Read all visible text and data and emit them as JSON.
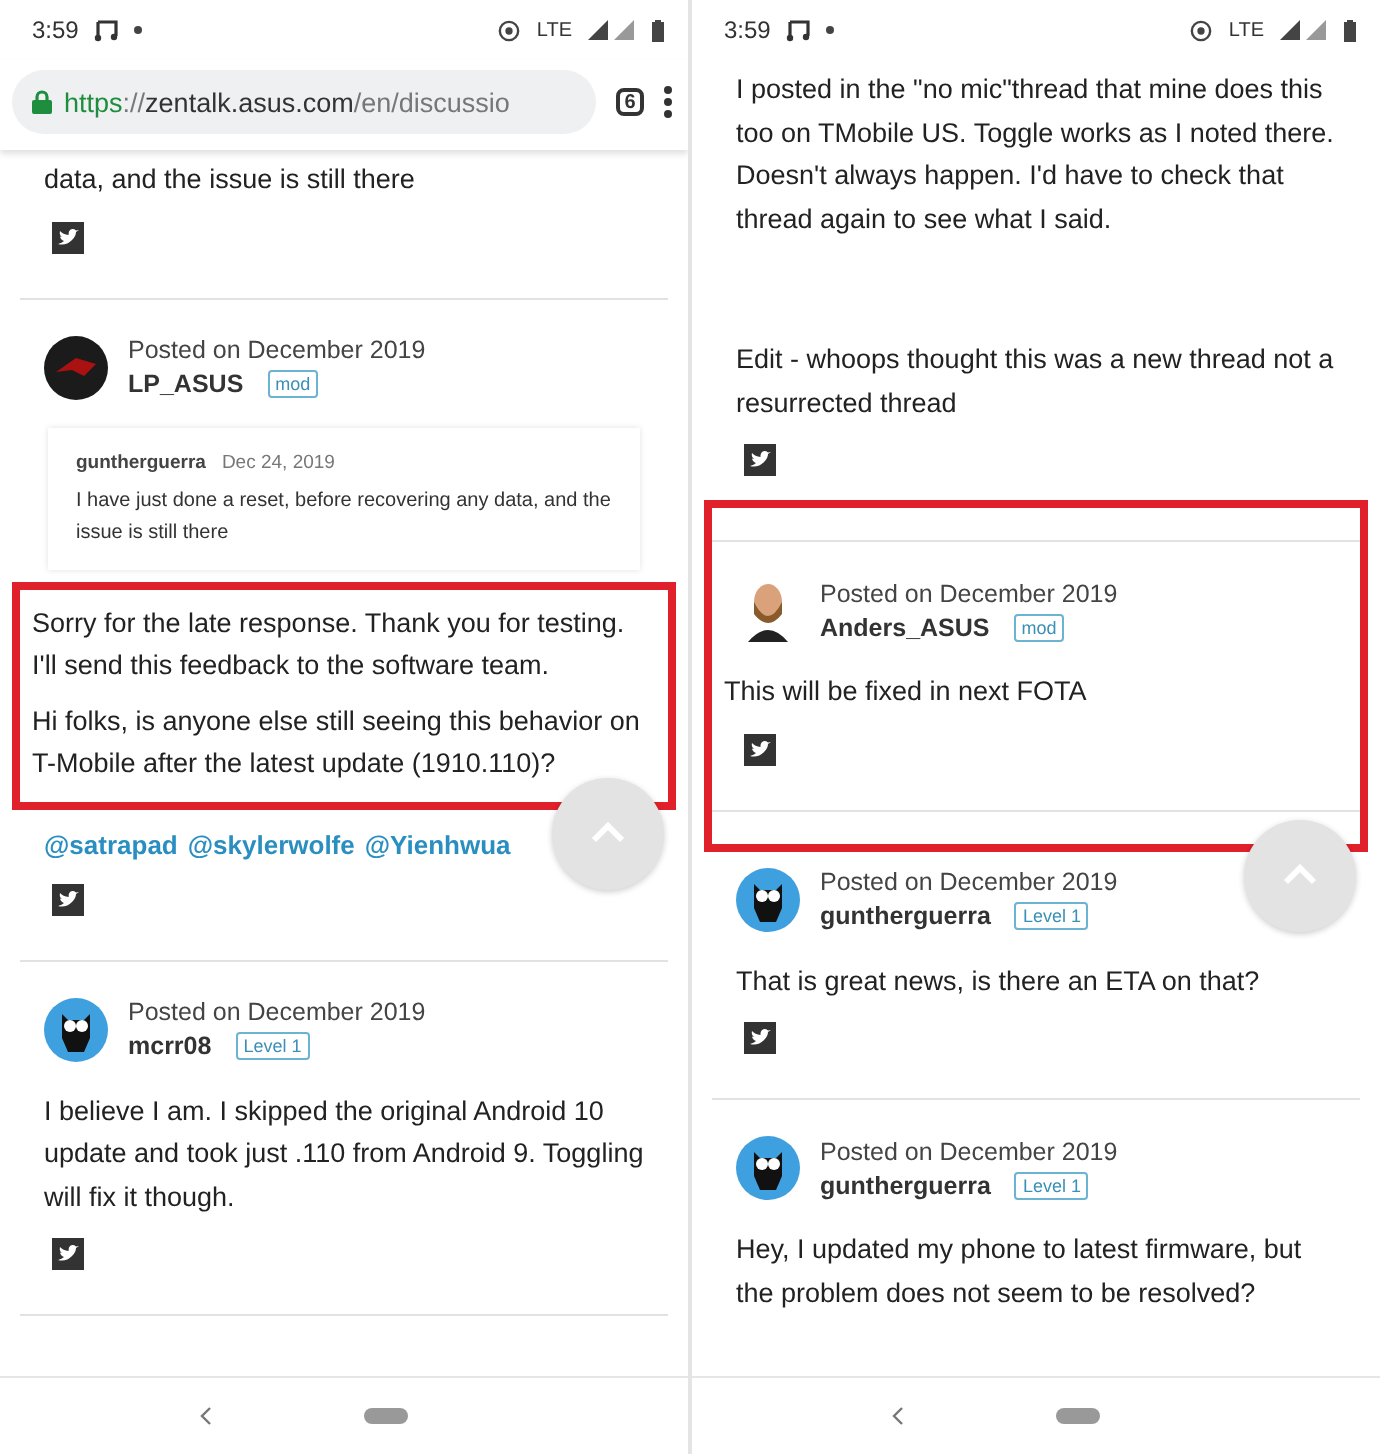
{
  "panels": [
    {
      "status_bar": {
        "time": "3:59",
        "network": "LTE"
      },
      "url_bar": {
        "url": [
          {
            "kind": "secure",
            "text": "https"
          },
          {
            "kind": "dim",
            "text": "://"
          },
          {
            "kind": "host",
            "text": "zentalk.asus.com"
          },
          {
            "kind": "dim",
            "text": "/en/discussio"
          }
        ],
        "tab_count": "6"
      },
      "blocks": [
        {
          "kind": "text",
          "text": "data, and the issue is still there"
        },
        {
          "kind": "share"
        },
        {
          "kind": "divider"
        },
        {
          "kind": "post_header",
          "avatar": {
            "kind": "logo"
          },
          "posted": "Posted on December 2019",
          "user": "LP_ASUS",
          "badge": "mod"
        },
        {
          "kind": "quote",
          "author": "guntherguerra",
          "date": "Dec 24, 2019",
          "text": "I have just done a reset, before recovering any data, and the issue is still there"
        },
        {
          "kind": "highlight",
          "children": [
            {
              "kind": "text",
              "text": "Sorry for the late response. Thank you for testing. I'll send this feedback to the software team."
            },
            {
              "kind": "text",
              "text": "Hi folks, is anyone else still seeing this behavior on T-Mobile after the latest update (1910.110)?"
            }
          ]
        },
        {
          "kind": "scroll_top"
        },
        {
          "kind": "mentions",
          "links": [
            "@satrapad",
            "@skylerwolfe",
            "@Yienhwua"
          ]
        },
        {
          "kind": "share"
        },
        {
          "kind": "divider"
        },
        {
          "kind": "post_header",
          "avatar": {
            "kind": "owl"
          },
          "posted": "Posted on December 2019",
          "user": "mcrr08",
          "badge": "Level 1"
        },
        {
          "kind": "text",
          "text": "I believe I am. I skipped the original Android 10 update and took just .110 from Android 9. Toggling will fix it though."
        },
        {
          "kind": "share"
        },
        {
          "kind": "divider"
        }
      ]
    },
    {
      "status_bar": {
        "time": "3:59",
        "network": "LTE"
      },
      "blocks": [
        {
          "kind": "text",
          "text": "I posted in the \"no mic\"thread that mine does this too on TMobile US. Toggle works as I noted there. Doesn't always happen. I'd have to check that thread again to see what I said."
        },
        {
          "kind": "blank"
        },
        {
          "kind": "text",
          "text": "Edit - whoops thought this was a new thread not a resurrected thread"
        },
        {
          "kind": "share"
        },
        {
          "kind": "highlight",
          "children": [
            {
              "kind": "divider"
            },
            {
              "kind": "post_header",
              "avatar": {
                "kind": "person"
              },
              "posted": "Posted on December 2019",
              "user": "Anders_ASUS",
              "badge": "mod"
            },
            {
              "kind": "text",
              "text": "This will be fixed in next FOTA"
            },
            {
              "kind": "share"
            },
            {
              "kind": "divider"
            }
          ]
        },
        {
          "kind": "scroll_top"
        },
        {
          "kind": "post_header",
          "avatar": {
            "kind": "owl"
          },
          "posted": "Posted on December 2019",
          "user": "guntherguerra",
          "badge": "Level 1"
        },
        {
          "kind": "text",
          "text": "That is great news, is there an ETA on that?"
        },
        {
          "kind": "share"
        },
        {
          "kind": "divider"
        },
        {
          "kind": "post_header",
          "avatar": {
            "kind": "owl"
          },
          "posted": "Posted on December 2019",
          "user": "guntherguerra",
          "badge": "Level 1"
        },
        {
          "kind": "text",
          "text": "Hey, I updated my phone to latest firmware, but the problem does not seem to be resolved?"
        }
      ]
    }
  ]
}
